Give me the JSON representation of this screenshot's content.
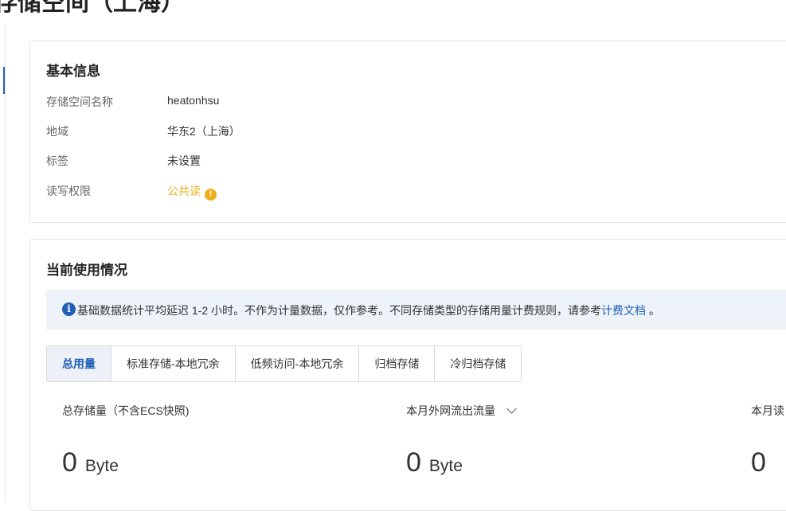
{
  "page": {
    "title": "存储空间（上海）"
  },
  "basic_info": {
    "title": "基本信息",
    "rows": [
      {
        "label": "存储空间名称",
        "value": "heatonhsu"
      },
      {
        "label": "地域",
        "value": "华东2（上海）"
      },
      {
        "label": "标签",
        "value": "未设置"
      },
      {
        "label": "读写权限",
        "value": "公共读"
      }
    ],
    "warn_color": "#f0ad1a"
  },
  "usage": {
    "title": "当前使用情况",
    "notice": {
      "text": "基础数据统计平均延迟 1-2 小时。不作为计量数据，仅作参考。不同存储类型的存储用量计费规则，请参考",
      "link": "计费文档",
      "suffix": " 。"
    },
    "tabs": [
      {
        "label": "总用量",
        "active": true
      },
      {
        "label": "标准存储-本地冗余",
        "active": false
      },
      {
        "label": "低频访问-本地冗余",
        "active": false
      },
      {
        "label": "归档存储",
        "active": false
      },
      {
        "label": "冷归档存储",
        "active": false
      }
    ],
    "metrics": [
      {
        "label": "总存储量（不含ECS快照)",
        "value": "0",
        "unit": "Byte"
      },
      {
        "label": "本月外网流出流量",
        "value": "0",
        "unit": "Byte"
      },
      {
        "label": "本月读",
        "value": "0",
        "unit": ""
      }
    ]
  },
  "colors": {
    "accent": "#1f5fb8",
    "warning": "#f0ad1a",
    "notice_bg": "#eef3f9"
  }
}
